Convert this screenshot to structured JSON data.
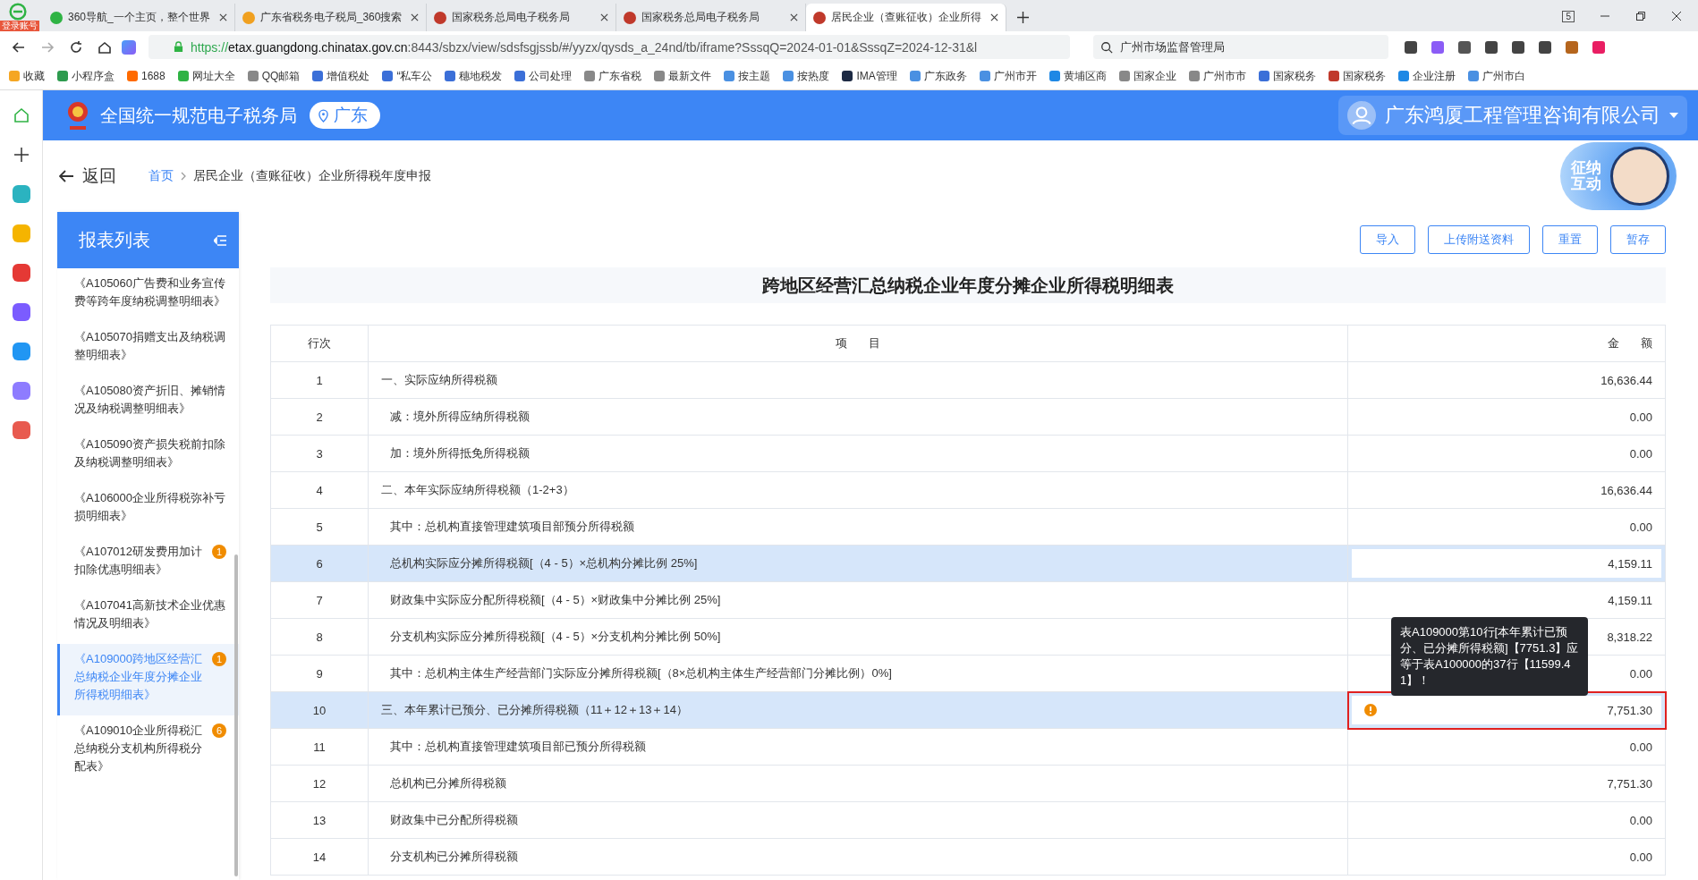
{
  "browser": {
    "login_badge": "登录账号",
    "tabs": [
      {
        "title": "360导航_一个主页，整个世界",
        "selected": false
      },
      {
        "title": "广东省税务电子税局_360搜索",
        "selected": false
      },
      {
        "title": "国家税务总局电子税务局",
        "selected": false
      },
      {
        "title": "国家税务总局电子税务局",
        "selected": false
      },
      {
        "title": "居民企业（查账征收）企业所得",
        "selected": true
      }
    ],
    "tab_count": "5",
    "url_scheme": "https://",
    "url_host": "etax.guangdong.chinatax.gov.cn",
    "url_rest": ":8443/sbzx/view/sdsfsgjssb/#/yyzx/qysds_a_24nd/tb/iframe?SssqQ=2024-01-01&SssqZ=2024-12-31&l",
    "search_value": "广州市场监督管理局",
    "bookmarks": [
      "收藏",
      "小程序盒",
      "1688",
      "网址大全",
      "QQ邮箱",
      "增值税处",
      "“私车公",
      "穗地税发",
      "公司处理",
      "广东省税",
      "最新文件",
      "按主题",
      "按热度",
      "IMA管理",
      "广东政务",
      "广州市开",
      "黄埔区商",
      "国家企业",
      "广州市市",
      "国家税务",
      "国家税务",
      "企业注册",
      "广州市白"
    ]
  },
  "header": {
    "site_title": "全国统一规范电子税务局",
    "region": "广东",
    "company": "广东鸿厦工程管理咨询有限公司"
  },
  "mascot_label": "征纳互动",
  "breadcrumb": {
    "back": "返回",
    "items": [
      "首页",
      "居民企业（查账征收）企业所得税年度申报"
    ]
  },
  "sidebar": {
    "title": "报表列表",
    "items": [
      {
        "label": "《A105060广告费和业务宣传费等跨年度纳税调整明细表》",
        "selected": false
      },
      {
        "label": "《A105070捐赠支出及纳税调整明细表》",
        "selected": false
      },
      {
        "label": "《A105080资产折旧、摊销情况及纳税调整明细表》",
        "selected": false
      },
      {
        "label": "《A105090资产损失税前扣除及纳税调整明细表》",
        "selected": false
      },
      {
        "label": "《A106000企业所得税弥补亏损明细表》",
        "selected": false
      },
      {
        "label": "《A107012研发费用加计扣除优惠明细表》",
        "badge": "1",
        "selected": false
      },
      {
        "label": "《A107041高新技术企业优惠情况及明细表》",
        "selected": false
      },
      {
        "label": "《A109000跨地区经营汇总纳税企业年度分摊企业所得税明细表》",
        "badge": "1",
        "selected": true
      },
      {
        "label": "《A109010企业所得税汇总纳税分支机构所得税分配表》",
        "badge": "6",
        "selected": false
      }
    ]
  },
  "toolbar_buttons": [
    "导入",
    "上传附送资料",
    "重置",
    "暂存"
  ],
  "form_title": "跨地区经营汇总纳税企业年度分摊企业所得税明细表",
  "table": {
    "columns": [
      "行次",
      "项 目",
      "金 额"
    ],
    "rows": [
      {
        "line": "1",
        "item": "一、实际应纳所得税额",
        "amount": "16,636.44",
        "kind": "section",
        "editable": false
      },
      {
        "line": "2",
        "item": "减：境外所得应纳所得税额",
        "amount": "0.00",
        "kind": "item",
        "editable": false
      },
      {
        "line": "3",
        "item": "加：境外所得抵免所得税额",
        "amount": "0.00",
        "kind": "item",
        "editable": false
      },
      {
        "line": "4",
        "item": "二、本年实际应纳所得税额（1-2+3）",
        "amount": "16,636.44",
        "kind": "section",
        "editable": false
      },
      {
        "line": "5",
        "item": "其中：总机构直接管理建筑项目部预分所得税额",
        "amount": "0.00",
        "kind": "item",
        "editable": false
      },
      {
        "line": "6",
        "item": "总机构实际应分摊所得税额[（4 - 5）×总机构分摊比例 25%]",
        "amount": "4,159.11",
        "kind": "item",
        "editable": true
      },
      {
        "line": "7",
        "item": "财政集中实际应分配所得税额[（4 - 5）×财政集中分摊比例 25%]",
        "amount": "4,159.11",
        "kind": "item",
        "editable": false
      },
      {
        "line": "8",
        "item": "分支机构实际应分摊所得税额[（4 - 5）×分支机构分摊比例 50%]",
        "amount": "8,318.22",
        "kind": "item",
        "editable": false
      },
      {
        "line": "9",
        "item": "其中：总机构主体生产经营部门实际应分摊所得税额[（8×总机构主体生产经营部门分摊比例）0%]",
        "amount": "0.00",
        "kind": "item",
        "editable": false
      },
      {
        "line": "10",
        "item": "三、本年累计已预分、已分摊所得税额（11＋12＋13＋14）",
        "amount": "7,751.30",
        "kind": "section",
        "editable": true,
        "error": "表A109000第10行[本年累计已预分、已分摊所得税额]【7751.3】应等于表A100000的37行【11599.41】！"
      },
      {
        "line": "11",
        "item": "其中：总机构直接管理建筑项目部已预分所得税额",
        "amount": "0.00",
        "kind": "item",
        "editable": false
      },
      {
        "line": "12",
        "item": "总机构已分摊所得税额",
        "amount": "7,751.30",
        "kind": "item",
        "editable": false
      },
      {
        "line": "13",
        "item": "财政集中已分配所得税额",
        "amount": "0.00",
        "kind": "item",
        "editable": false
      },
      {
        "line": "14",
        "item": "分支机构已分摊所得税额",
        "amount": "0.00",
        "kind": "item",
        "editable": false
      }
    ]
  }
}
